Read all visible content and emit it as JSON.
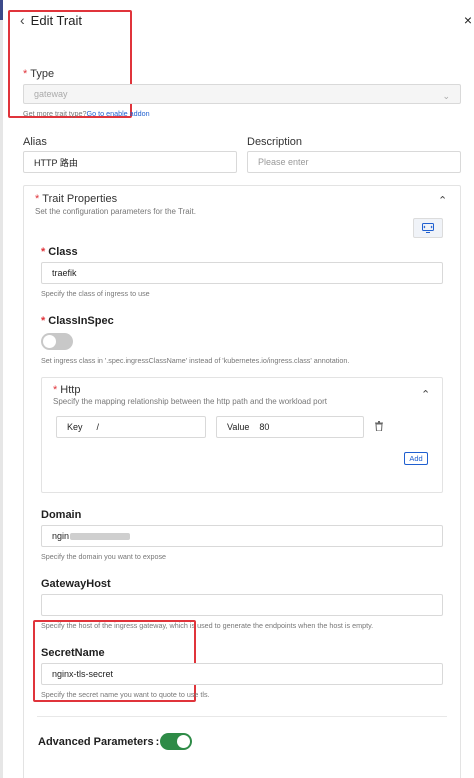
{
  "header": {
    "title": "Edit Trait",
    "close": "×"
  },
  "type_field": {
    "label": "Type",
    "value": "gateway",
    "help_prefix": "Get more trait type?",
    "help_link": "Go to enable addon"
  },
  "alias": {
    "label": "Alias",
    "value": "HTTP 路由"
  },
  "description": {
    "label": "Description",
    "placeholder": "Please enter"
  },
  "trait_properties": {
    "title": "Trait Properties",
    "subtitle": "Set the configuration parameters for the Trait.",
    "class": {
      "label": "Class",
      "value": "traefik",
      "help": "Specify the class of ingress to use"
    },
    "class_in_spec": {
      "label": "ClassInSpec",
      "enabled": false,
      "help": "Set ingress class in '.spec.ingressClassName' instead of 'kubernetes.io/ingress.class' annotation."
    },
    "http": {
      "label": "Http",
      "help": "Specify the mapping relationship between the http path and the workload port",
      "key_label": "Key",
      "key_value": "/",
      "value_label": "Value",
      "value_value": "80",
      "add_label": "Add"
    },
    "domain": {
      "label": "Domain",
      "value_prefix": "ngin",
      "help": "Specify the domain you want to expose"
    },
    "gateway_host": {
      "label": "GatewayHost",
      "value": "",
      "help": "Specify the host of the ingress gateway, which is used to generate the endpoints when the host is empty."
    },
    "secret_name": {
      "label": "SecretName",
      "value": "nginx-tls-secret",
      "help": "Specify the secret name you want to quote to use tls."
    },
    "advanced": {
      "label": "Advanced Parameters",
      "enabled": true
    }
  },
  "colors": {
    "accent": "#1f5fd0",
    "required": "#e0343b",
    "toggle_on": "#2e8b47",
    "highlight": "#e0343b"
  }
}
